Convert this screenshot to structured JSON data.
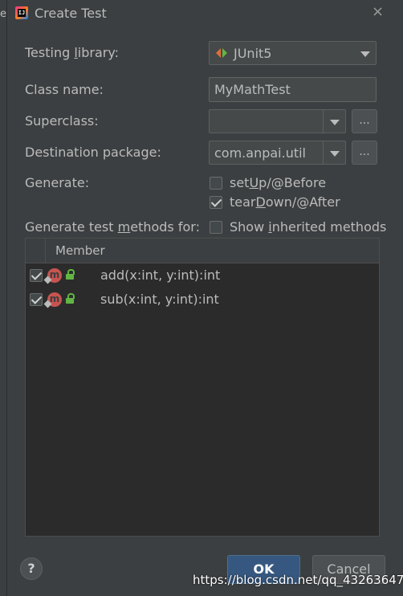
{
  "background_fragment": "el",
  "dialog": {
    "title": "Create Test",
    "close_glyph": "×"
  },
  "form": {
    "testing_library": {
      "label": "Testing library:",
      "value": "JUnit5"
    },
    "class_name": {
      "label": "Class name:",
      "value": "MyMathTest"
    },
    "superclass": {
      "label": "Superclass:",
      "value": "",
      "browse": "..."
    },
    "destination_package": {
      "label": "Destination package:",
      "value": "com.anpai.util",
      "browse": "..."
    },
    "generate": {
      "label": "Generate:",
      "options": [
        {
          "label": "setUp/@Before",
          "checked": false
        },
        {
          "label": "tearDown/@After",
          "checked": true
        }
      ]
    },
    "methods_for": {
      "label": "Generate test methods for:"
    },
    "show_inherited": {
      "label": "Show inherited methods",
      "checked": false
    }
  },
  "table": {
    "header": "Member",
    "rows": [
      {
        "signature": "add(x:int, y:int):int",
        "checked": true,
        "icon_letter": "m"
      },
      {
        "signature": "sub(x:int, y:int):int",
        "checked": true,
        "icon_letter": "m"
      }
    ]
  },
  "buttons": {
    "help": "?",
    "ok": "OK",
    "cancel": "Cancel"
  },
  "watermark": "https://blog.csdn.net/qq_43263647",
  "colors": {
    "dialog_bg": "#3c3f41",
    "field_bg": "#45494a",
    "ok_button": "#365880",
    "method_icon": "#c75450",
    "lock_icon": "#62b543"
  }
}
